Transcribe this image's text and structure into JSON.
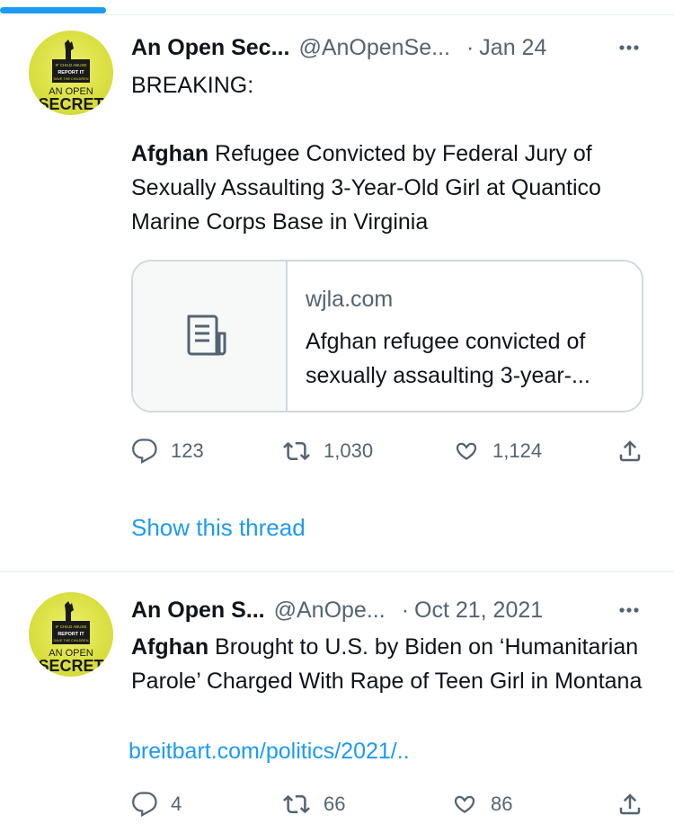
{
  "tweets": [
    {
      "author_name": "An Open Sec...",
      "handle": "@AnOpenSe...",
      "separator": "·",
      "time": "Jan 24",
      "text_line1": "BREAKING:",
      "bold_word": "Afghan",
      "text_rest": " Refugee Convicted by Federal Jury of Sexually Assaulting 3-Year-Old Girl at Quantico Marine Corps Base in Virginia",
      "card": {
        "domain": "wjla.com",
        "title": "Afghan refugee convicted of sexually assaulting 3-year-..."
      },
      "actions": {
        "replies": "123",
        "retweets": "1,030",
        "likes": "1,124"
      },
      "show_thread": "Show this thread"
    },
    {
      "author_name": "An Open S...",
      "handle": "@AnOpe...",
      "separator": "·",
      "time": "Oct 21, 2021",
      "bold_word": "Afghan",
      "text_rest": " Brought to U.S. by Biden on ‘Humanitarian Parole’ Charged With Rape of Teen Girl in Montana",
      "link": "breitbart.com/politics/2021/..",
      "actions": {
        "replies": "4",
        "retweets": "66",
        "likes": "86"
      }
    }
  ],
  "avatar_text": {
    "line1": "AN OPEN",
    "line2": "SECRET",
    "badge_line1": "IF CHILD ABUSE",
    "badge_line2": "REPORT IT",
    "badge_line3": "SAVE THE CHILDREN"
  },
  "colors": {
    "accent": "#1d9bf0",
    "secondary_text": "#536471",
    "primary_text": "#0f1419",
    "avatar_bg": "#d6dc3a"
  },
  "icons": {
    "more": "more-horizontal-icon",
    "reply": "reply-icon",
    "retweet": "retweet-icon",
    "like": "heart-icon",
    "share": "share-icon",
    "card": "document-icon"
  }
}
